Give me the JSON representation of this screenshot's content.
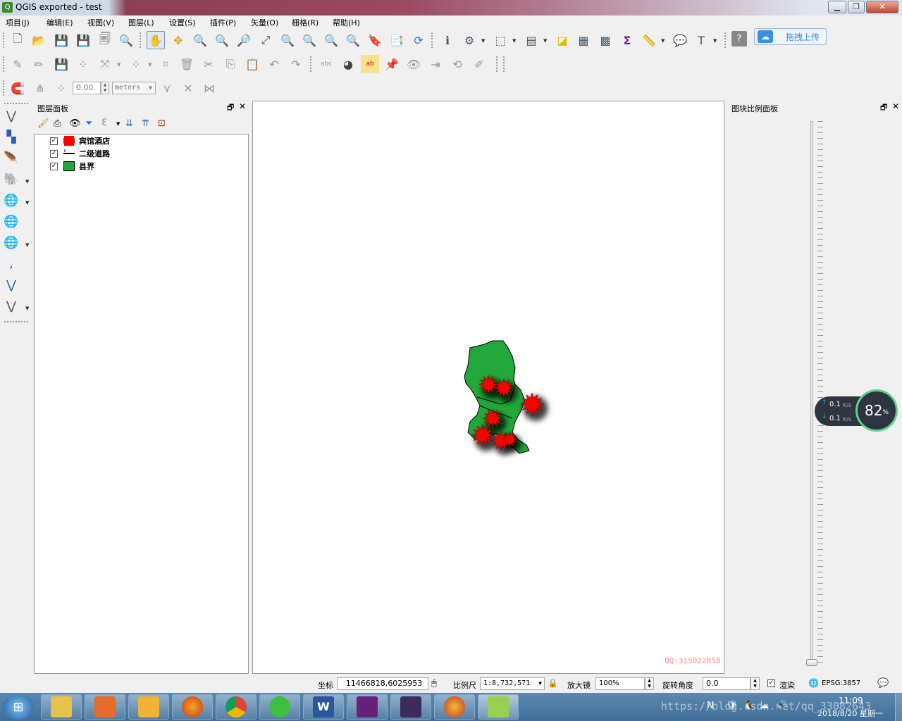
{
  "window": {
    "title": "QGIS exported - test"
  },
  "menu": [
    "项目(J)",
    "编辑(E)",
    "视图(V)",
    "图层(L)",
    "设置(S)",
    "插件(P)",
    "矢量(O)",
    "栅格(R)",
    "帮助(H)"
  ],
  "upload_button": "拖拽上传",
  "digitize": {
    "value": "0.00",
    "unit": "meters"
  },
  "layers_panel": {
    "title": "图层面板",
    "layers": [
      {
        "name": "宾馆酒店",
        "checked": "✓",
        "color": "#ff0000"
      },
      {
        "name": "二级道路",
        "checked": "✓",
        "color": "#000000"
      },
      {
        "name": "县界",
        "checked": "✓",
        "color": "#22a83a"
      }
    ]
  },
  "scale_panel": {
    "title": "图块比例面板"
  },
  "map": {
    "watermark": "QQ:315022850"
  },
  "status": {
    "coord_label": "坐标",
    "coord": "11466818,6025953",
    "scale_label": "比例尺",
    "scale": "1:8,732,571",
    "mag_label": "放大镜",
    "mag": "100%",
    "rot_label": "旋转角度",
    "rot": "0.0",
    "render_label": "渲染",
    "crs": "EPSG:3857"
  },
  "netwidget": {
    "up": "0.1",
    "down": "0.1",
    "unit": "K/s",
    "percent": "82",
    "pct_sign": "%"
  },
  "clock": {
    "time": "11:09",
    "date": "2018/8/20 星期一"
  },
  "url_watermark": "https://blog.csdn.net/qq_33082643"
}
